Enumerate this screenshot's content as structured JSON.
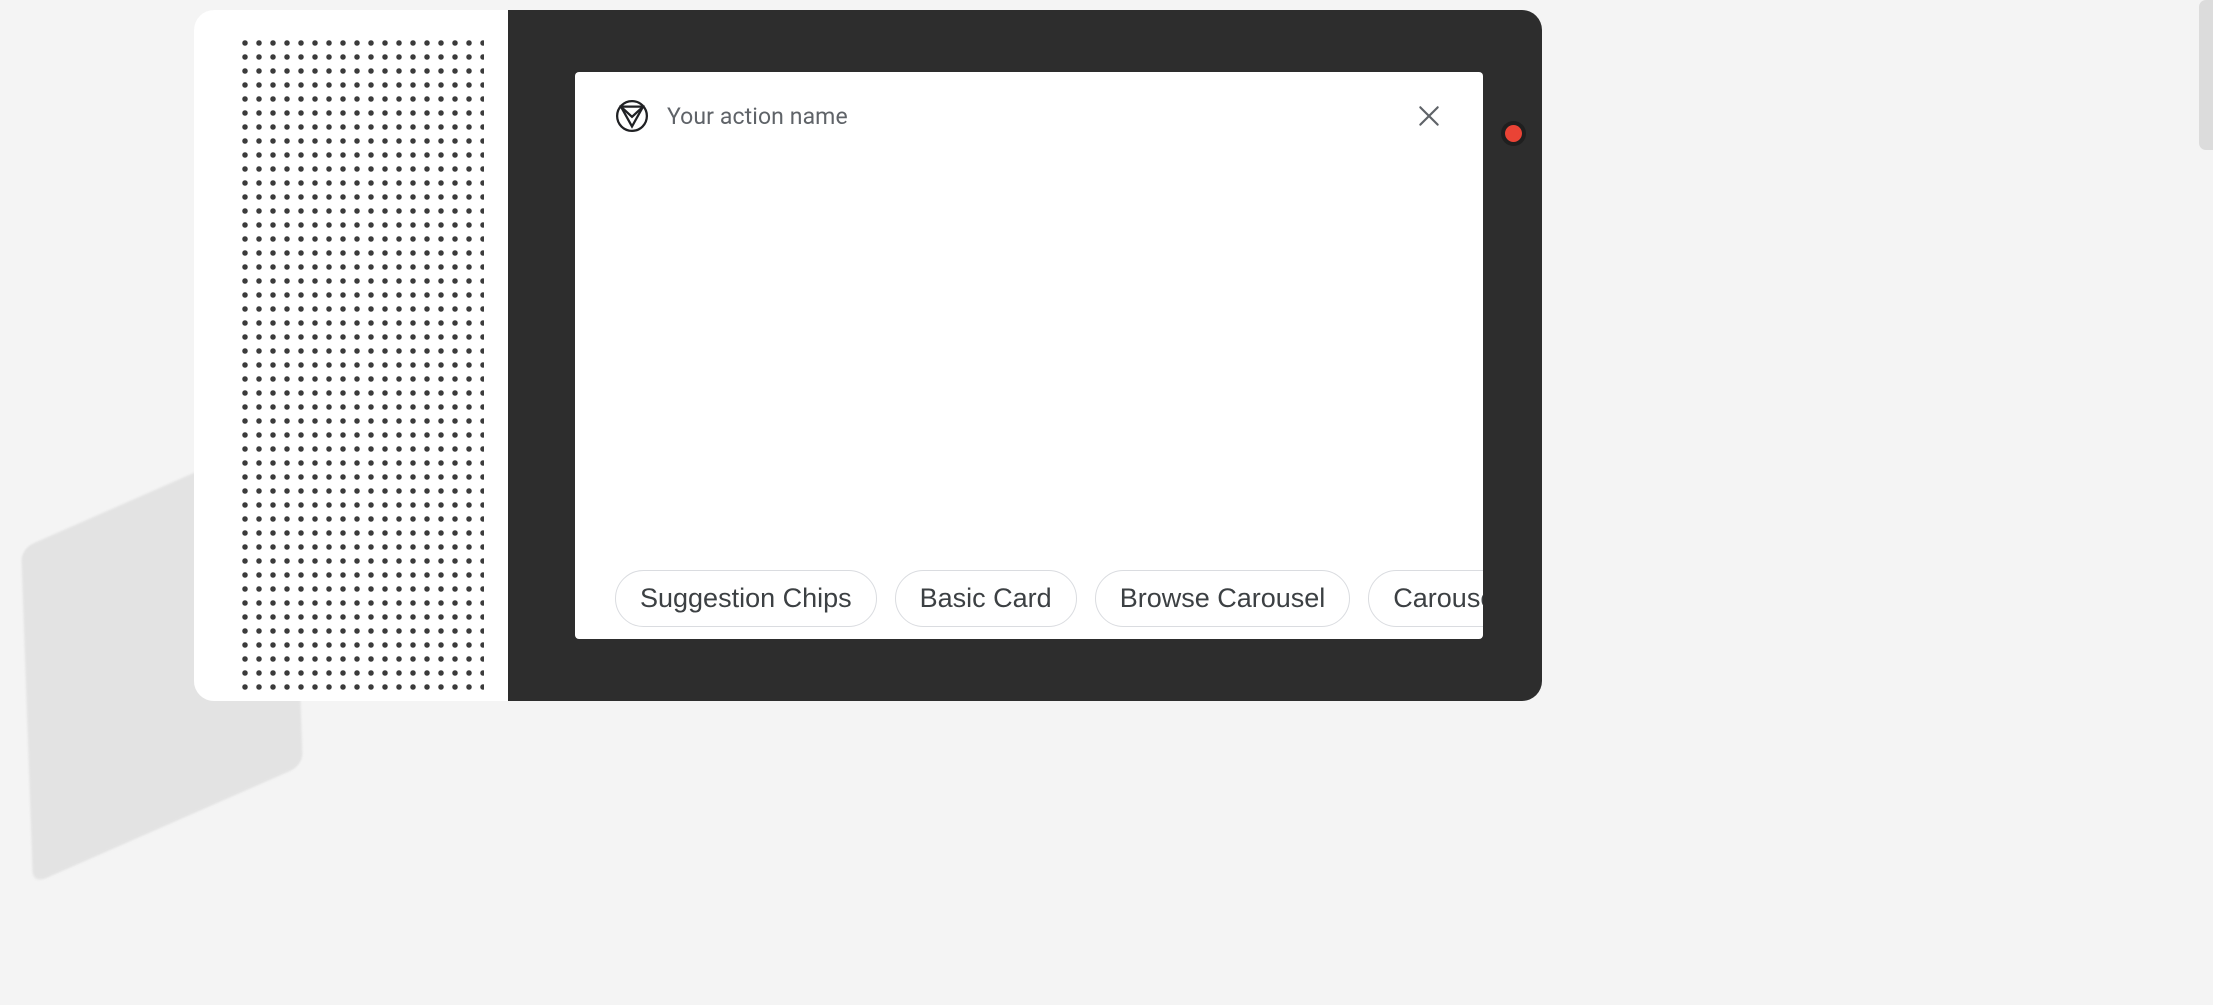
{
  "header": {
    "action_name": "Your action name"
  },
  "chips": [
    {
      "label": "Suggestion Chips"
    },
    {
      "label": "Basic Card"
    },
    {
      "label": "Browse Carousel"
    },
    {
      "label": "Carousel"
    }
  ],
  "icons": {
    "app": "material-logo-icon",
    "close": "close-icon",
    "led": "recording-led"
  },
  "colors": {
    "bezel": "#2d2d2d",
    "led": "#ea4335",
    "text_muted": "#5f6368",
    "chip_border": "#dadce0"
  }
}
